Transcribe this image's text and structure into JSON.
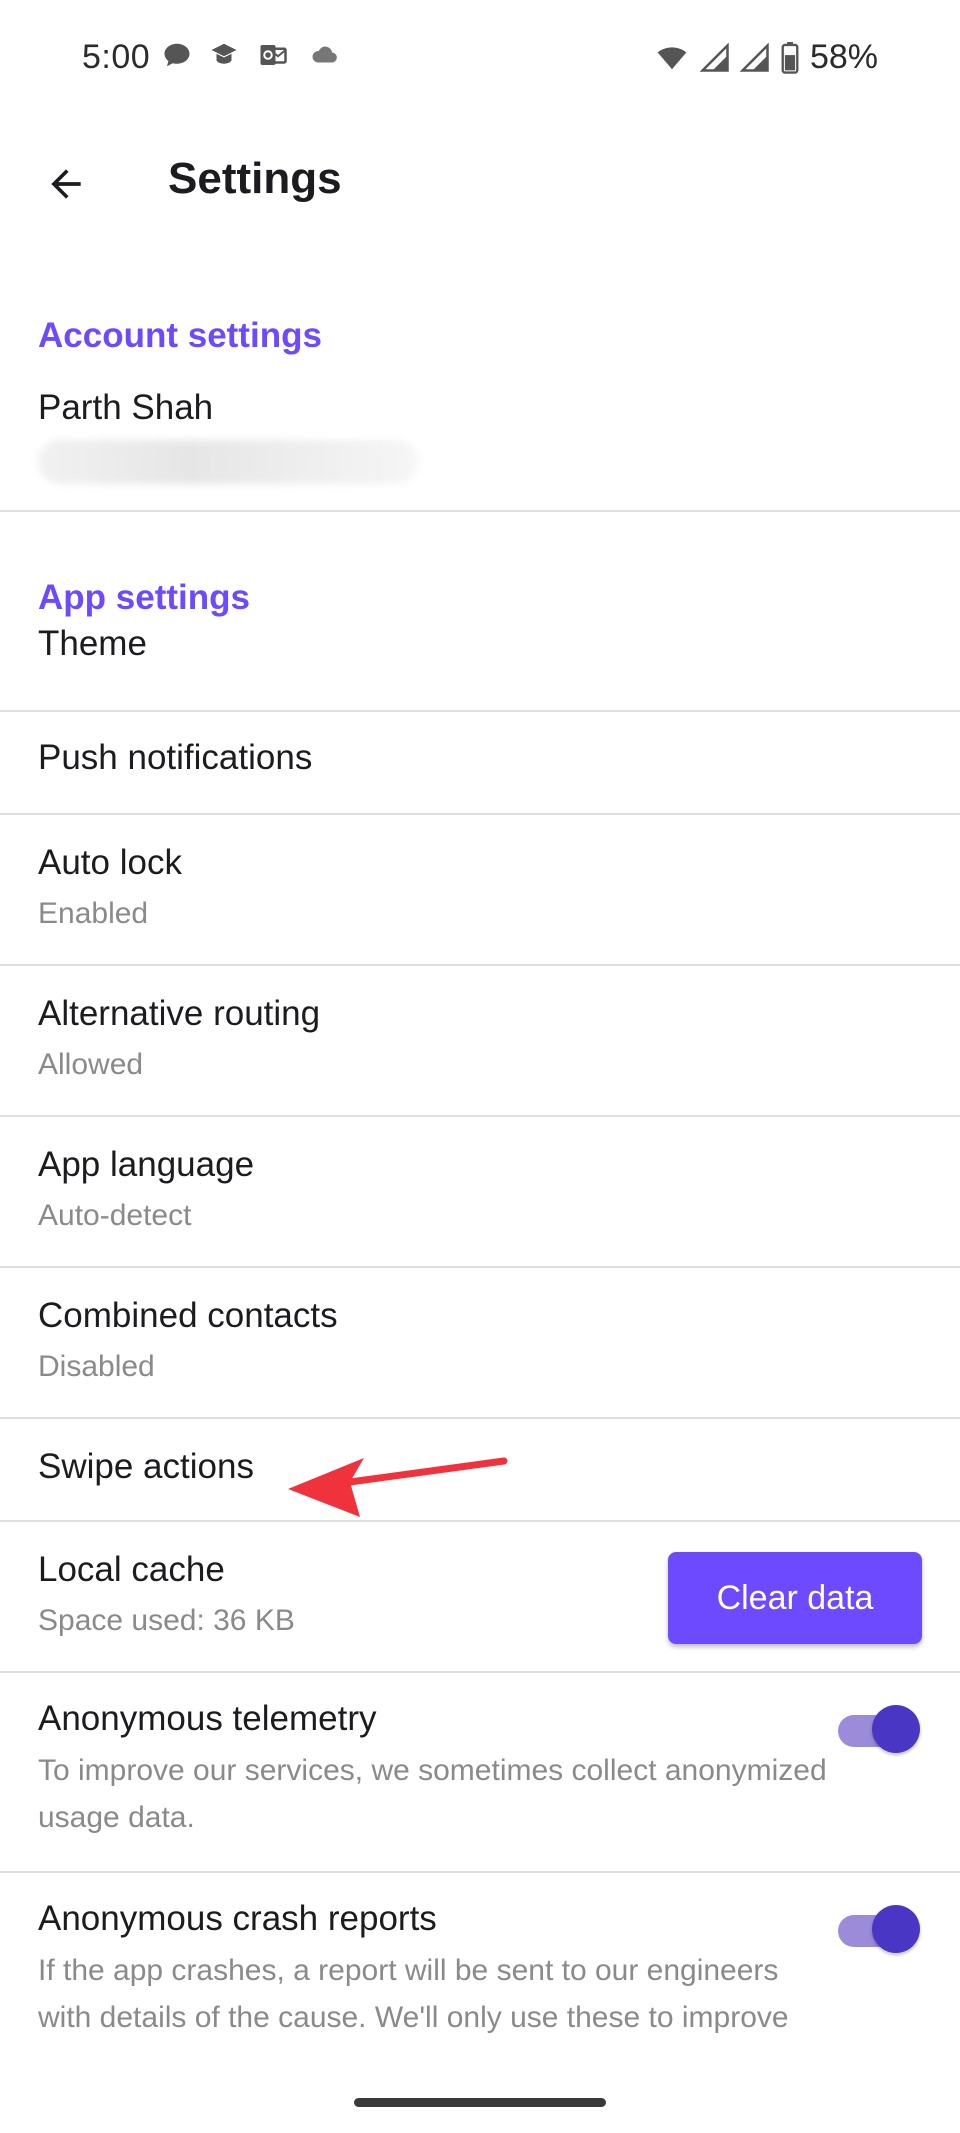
{
  "status_bar": {
    "time": "5:00",
    "battery": "58%",
    "icons": [
      "chat-icon",
      "graduation-cap-icon",
      "outlook-icon",
      "cloud-icon",
      "wifi-icon",
      "signal-icon",
      "signal-icon",
      "battery-icon"
    ]
  },
  "app_bar": {
    "title": "Settings",
    "back_icon": "arrow-back-icon"
  },
  "account_settings": {
    "header": "Account settings",
    "name": "Parth Shah"
  },
  "app_settings": {
    "header": "App settings",
    "items": [
      {
        "title": "Theme"
      },
      {
        "title": "Push notifications"
      },
      {
        "title": "Auto lock",
        "subtitle": "Enabled"
      },
      {
        "title": "Alternative routing",
        "subtitle": "Allowed"
      },
      {
        "title": "App language",
        "subtitle": "Auto-detect"
      },
      {
        "title": "Combined contacts",
        "subtitle": "Disabled"
      },
      {
        "title": "Swipe actions"
      },
      {
        "title": "Local cache",
        "subtitle": "Space used: 36 KB",
        "button": "Clear data"
      },
      {
        "title": "Anonymous telemetry",
        "description": "To improve our services, we sometimes collect anonymized usage data.",
        "enabled": true
      },
      {
        "title": "Anonymous crash reports",
        "description": "If the app crashes, a report will be sent to our engineers with details of the cause. We'll only use these to improve",
        "enabled": true
      }
    ]
  },
  "colors": {
    "accent": "#6d4aff",
    "toggle_thumb": "#4a36c4",
    "toggle_track": "#9b8bd9",
    "annotation_arrow": "#f0323c"
  }
}
